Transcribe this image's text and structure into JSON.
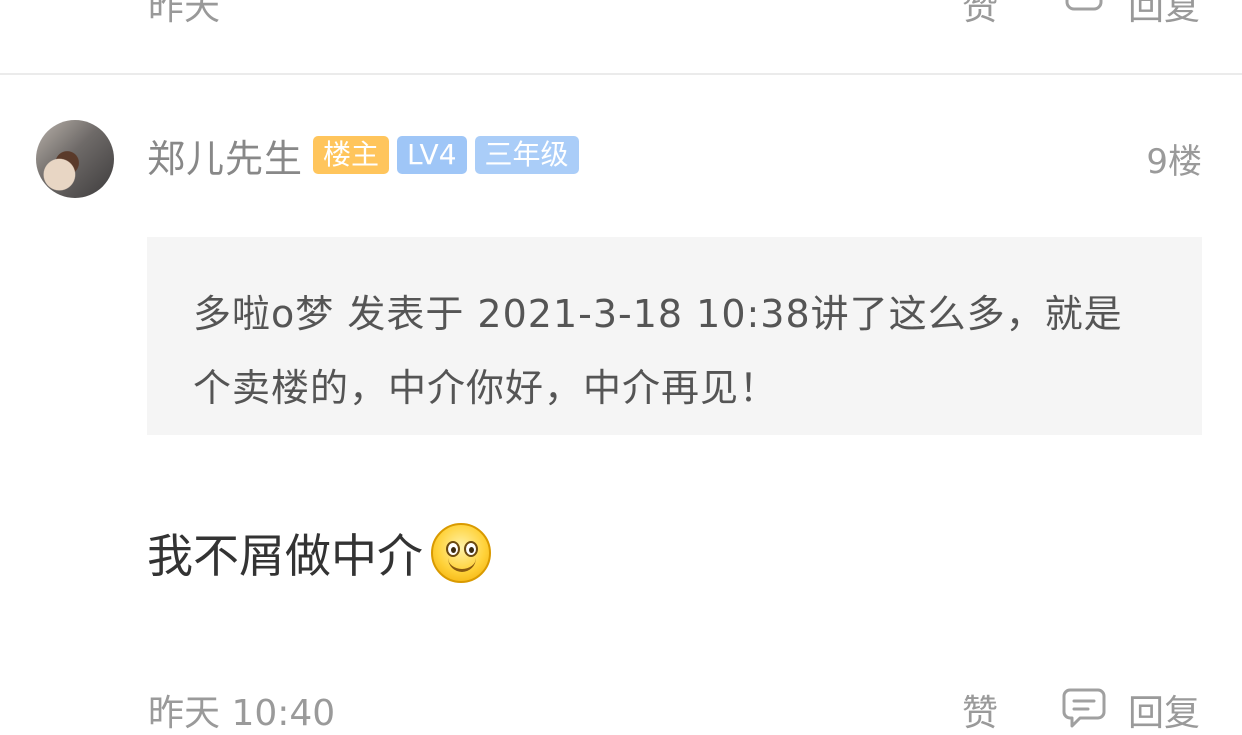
{
  "prev_footer": {
    "time": "昨天",
    "like": "赞",
    "reply": "回复"
  },
  "post": {
    "username": "郑儿先生",
    "badges": {
      "owner": "楼主",
      "level": "LV4",
      "grade": "三年级"
    },
    "floor": "9楼",
    "quote": "多啦o梦 发表于 2021-3-18 10:38讲了这么多，就是个卖楼的，中介你好，中介再见！",
    "content": "我不屑做中介",
    "time": "昨天 10:40",
    "like_label": "赞",
    "reply_label": "回复"
  },
  "icons": {
    "avatar": "user-avatar",
    "emoji": "smile-emoji",
    "comment": "comment-bubble-icon"
  },
  "colors": {
    "owner_badge": "#ffc55c",
    "level_badge": "#9fc6f7",
    "grade_badge": "#aacdf8",
    "quote_bg": "#f5f5f5",
    "meta_text": "#9a9a9a"
  }
}
